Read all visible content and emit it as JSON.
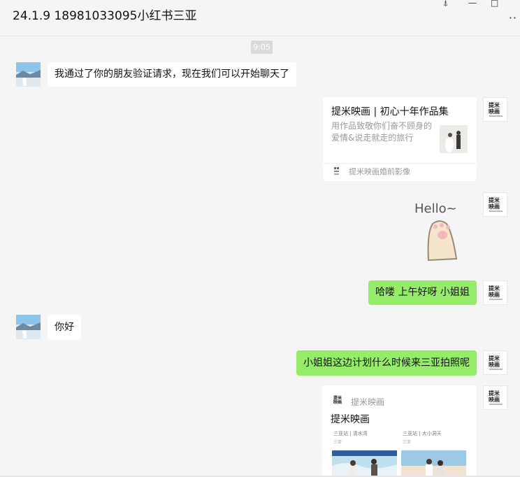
{
  "header": {
    "title": "24.1.9 18981033095小红书三亚",
    "pin_icon": "pin-icon",
    "minimize_icon": "minimize-icon",
    "maximize_icon": "maximize-icon",
    "more_icon": "more-icon",
    "pin_glyph": "⍋",
    "minimize_glyph": "—",
    "maximize_glyph": "□",
    "more_glyph": "··"
  },
  "chat": {
    "timestamp": "9:05",
    "logo_text": "提米\n映画",
    "messages": {
      "m1": "我通过了你的朋友验证请求，现在我们可以开始聊天了",
      "m2": "哈喽 上午好呀 小姐姐",
      "m3": "你好",
      "m4": "小姐姐这边计划什么时候来三亚拍照呢"
    },
    "card1": {
      "title": "提米映画 | 初心十年作品集",
      "desc": "用作品致敬你们奋不顾身的爱情&说走就走的旅行",
      "source": "提米映画婚前影像"
    },
    "sticker": {
      "text": "Hello~"
    },
    "card2": {
      "logo": "提米\n映画",
      "account": "提米映画",
      "title": "提米映画",
      "item1_title": "三亚站 | 清水湾",
      "item1_sub": "三亚",
      "item2_title": "三亚站 | 大小洞天",
      "item2_sub": "三亚"
    }
  },
  "colors": {
    "self_bubble": "#95ec69",
    "other_bubble": "#ffffff",
    "background": "#f5f5f5"
  }
}
